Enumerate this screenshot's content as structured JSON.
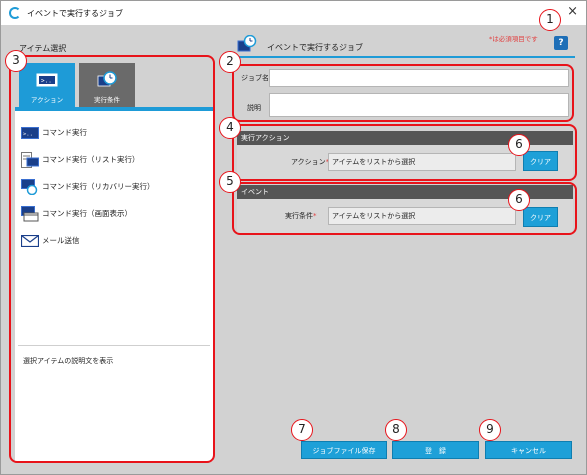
{
  "window": {
    "title": "イベントで実行するジョブ",
    "close_label": "×"
  },
  "left": {
    "title": "アイテム選択",
    "tabs": [
      {
        "label": "アクション",
        "icon": "action-icon"
      },
      {
        "label": "実行条件",
        "icon": "condition-icon"
      }
    ],
    "items": [
      {
        "label": "コマンド実行",
        "icon": "command-icon"
      },
      {
        "label": "コマンド実行（リスト実行）",
        "icon": "command-list-icon"
      },
      {
        "label": "コマンド実行（リカバリー実行）",
        "icon": "command-recovery-icon"
      },
      {
        "label": "コマンド実行（画面表示）",
        "icon": "command-screen-icon"
      },
      {
        "label": "メール送信",
        "icon": "mail-icon"
      }
    ],
    "description": "選択アイテムの説明文を表示"
  },
  "right": {
    "title": "イベントで実行するジョブ",
    "required_note": "*は必須項目です",
    "help_label": "?",
    "job_name_label": "ジョブ名",
    "job_name_req": "*",
    "job_name_value": "",
    "desc_label": "説明",
    "desc_value": "",
    "action_section": {
      "title": "実行アクション",
      "field_label": "アクション",
      "req": "*",
      "value": "アイテムをリストから選択",
      "clear_label": "クリア"
    },
    "event_section": {
      "title": "イベント",
      "field_label": "実行条件",
      "req": "*",
      "value": "アイテムをリストから選択",
      "clear_label": "クリア"
    }
  },
  "bottom": {
    "save_file_label": "ジョブファイル保存",
    "register_label": "登　録",
    "cancel_label": "キャンセル"
  },
  "annotations": [
    "1",
    "2",
    "3",
    "4",
    "5",
    "6",
    "6",
    "7",
    "8",
    "9"
  ],
  "colors": {
    "accent": "#1ea0d8",
    "annotation": "#e8131a",
    "dark_header": "#555555"
  }
}
